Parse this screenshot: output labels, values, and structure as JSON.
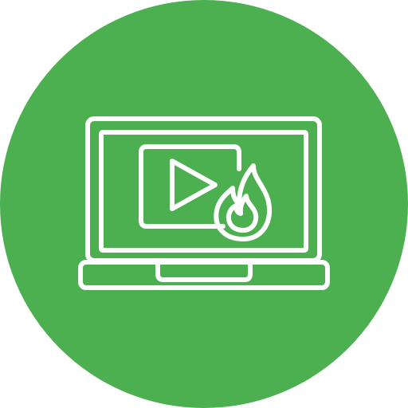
{
  "icon": {
    "name": "trending-video-laptop-icon",
    "background_color": "#4caf50",
    "foreground_color": "#ffffff",
    "parts": [
      "circle-background",
      "laptop-icon",
      "video-player-icon",
      "play-icon",
      "fire-icon"
    ]
  }
}
